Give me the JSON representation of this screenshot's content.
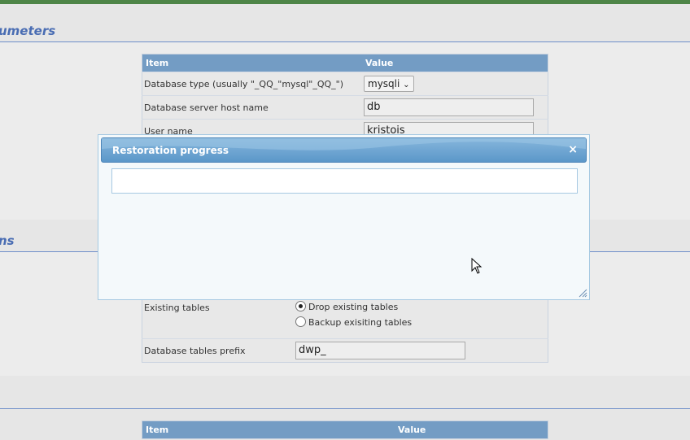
{
  "sections": {
    "s1_title": "umeters",
    "s2_title": "ns"
  },
  "db_table": {
    "headers": [
      "Item",
      "Value"
    ],
    "rows": [
      {
        "label": "Database type (usually \"_QQ_\"mysql\"_QQ_\")",
        "value": "mysqli"
      },
      {
        "label": "Database server host name",
        "value": "db"
      },
      {
        "label": "User name",
        "value": "kristois"
      }
    ]
  },
  "options_table": {
    "existing_label": "Existing tables",
    "drop_label": "Drop existing tables",
    "backup_label": "Backup exisiting tables",
    "prefix_label": "Database tables prefix",
    "prefix_value": "dwp_"
  },
  "bottom_table": {
    "headers": [
      "Item",
      "Value"
    ]
  },
  "dialog": {
    "title": "Restoration progress",
    "close_glyph": "×",
    "progress": ""
  }
}
